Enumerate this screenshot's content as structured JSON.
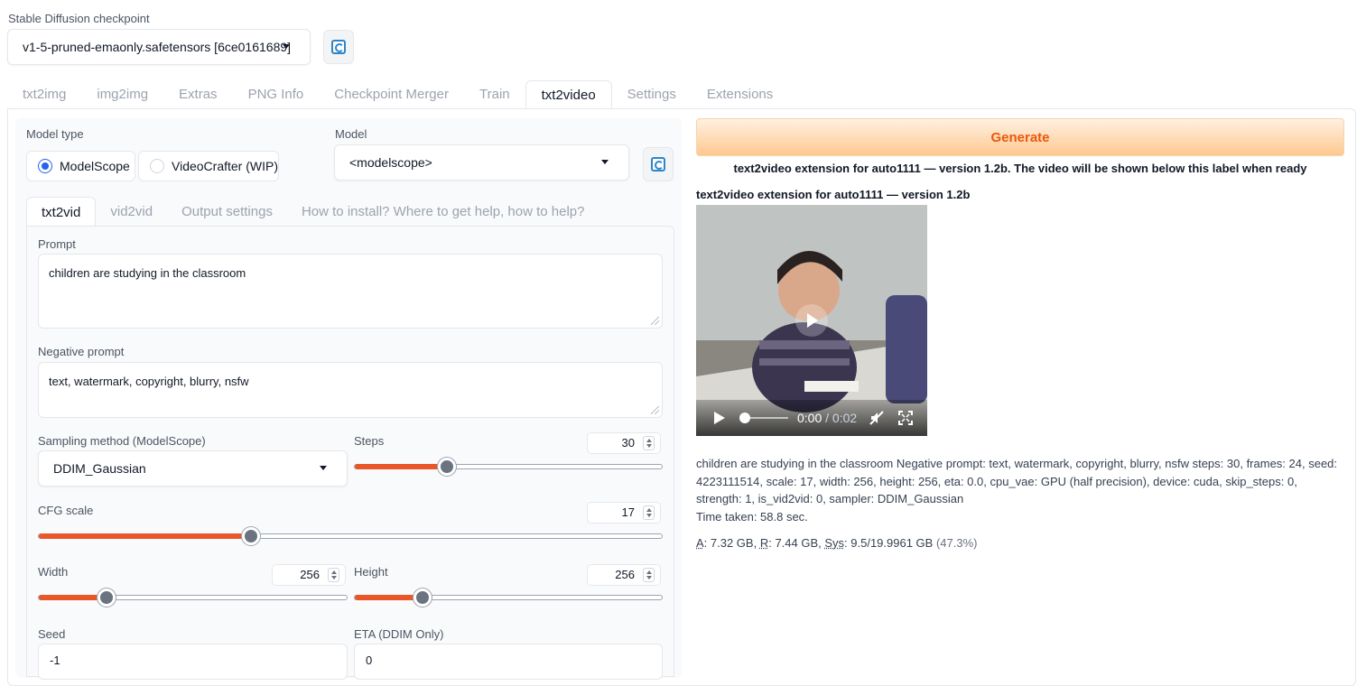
{
  "checkpoint": {
    "label": "Stable Diffusion checkpoint",
    "value": "v1-5-pruned-emaonly.safetensors [6ce0161689]"
  },
  "tabs": [
    "txt2img",
    "img2img",
    "Extras",
    "PNG Info",
    "Checkpoint Merger",
    "Train",
    "txt2video",
    "Settings",
    "Extensions"
  ],
  "active_tab": "txt2video",
  "left": {
    "model_type_label": "Model type",
    "model_type_options": [
      "ModelScope",
      "VideoCrafter (WIP)"
    ],
    "model_label": "Model",
    "model_value": "<modelscope>",
    "subtabs": [
      "txt2vid",
      "vid2vid",
      "Output settings",
      "How to install? Where to get help, how to help?"
    ],
    "prompt_label": "Prompt",
    "prompt_value": "children are studying in the classroom",
    "neg_label": "Negative prompt",
    "neg_value": "text, watermark, copyright, blurry, nsfw",
    "sampler_label": "Sampling method (ModelScope)",
    "sampler_value": "DDIM_Gaussian",
    "steps_label": "Steps",
    "steps_value": "30",
    "cfg_label": "CFG scale",
    "cfg_value": "17",
    "width_label": "Width",
    "width_value": "256",
    "height_label": "Height",
    "height_value": "256",
    "seed_label": "Seed",
    "seed_value": "-1",
    "eta_label": "ETA (DDIM Only)",
    "eta_value": "0"
  },
  "sliders": {
    "steps_fraction": 0.3,
    "cfg_fraction": 0.34,
    "width_fraction": 0.22,
    "height_fraction": 0.22
  },
  "right": {
    "generate_label": "Generate",
    "status_line": "text2video extension for auto1111 — version 1.2b. The video will be shown below this label when ready",
    "video_title": "text2video extension for auto1111 — version 1.2b",
    "time_current": "0:00",
    "time_total": "/ 0:02",
    "info": "children are studying in the classroom Negative prompt: text, watermark, copyright, blurry, nsfw steps: 30, frames: 24, seed: 4223111514, scale: 17, width: 256, height: 256, eta: 0.0, cpu_vae: GPU (half precision), device: cuda, skip_steps: 0, strength: 1, is_vid2vid: 0, sampler: DDIM_Gaussian",
    "time_taken": "Time taken: 58.8 sec.",
    "mem": {
      "a_label": "A",
      "a_value": ": 7.32 GB, ",
      "r_label": "R",
      "r_value": ": 7.44 GB, ",
      "sys_label": "Sys",
      "sys_value": ": 9.5/19.9961 GB ",
      "pct": "(47.3%)"
    }
  },
  "colors": {
    "accent": "#e8562a",
    "generate_text": "#ea580c",
    "radio": "#2563eb",
    "refresh_icon": "#2f86c7"
  }
}
